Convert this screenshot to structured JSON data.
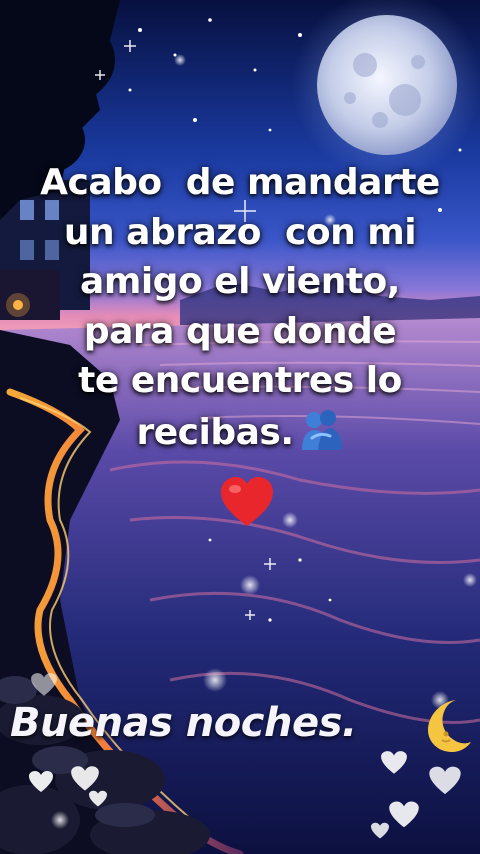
{
  "message": {
    "lines": [
      "Acabo  de mandarte",
      "un abrazo  con mi",
      "amigo el viento,",
      "para que donde",
      "te encuentres lo",
      "recibas."
    ]
  },
  "greeting": "Buenas noches.",
  "icons": {
    "hug": "people-hugging-icon",
    "heart": "red-heart-icon",
    "moon": "crescent-moon-icon",
    "small_hearts": "white-heart-icon",
    "full_moon": "full-moon"
  },
  "colors": {
    "sky_top": "#0b1a5e",
    "sky_horizon": "#e88bb0",
    "sea": "#1e2a6e",
    "shore_glow": "#ffa03a",
    "heart": "#e8262c",
    "hug": "#3f7fd8",
    "text": "#ffffff"
  }
}
